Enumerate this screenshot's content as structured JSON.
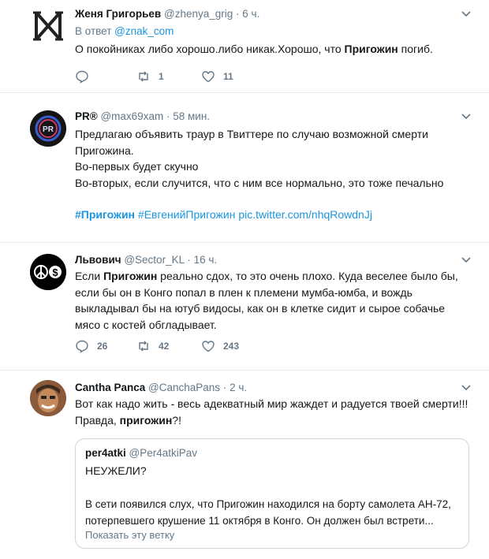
{
  "tweets": [
    {
      "name": "Женя Григорьев",
      "handle": "@zhenya_grig",
      "dot": "·",
      "time": "6 ч.",
      "reply_prefix": "В ответ ",
      "reply_handle": "@znak_com",
      "text_1": "О покойниках либо хорошо.либо никак.Хорошо, что ",
      "text_bold": "Пригожин",
      "text_2": " погиб.",
      "replies": "",
      "retweets": "1",
      "likes": "11"
    },
    {
      "name": "PR®",
      "handle": "@max69xam",
      "dot": "·",
      "time": "58 мин.",
      "line1": "Предлагаю объявить траур в Твиттере по случаю возможной смерти",
      "line2": "Пригожина.",
      "line3": "Во-первых будет скучно",
      "line4": "Во-вторых, если случится, что с ним все нормально, это тоже печально",
      "hashtag_bold": "#Пригожин",
      "hashtag2": " #ЕвгенийПригожин",
      "pic_link": " pic.twitter.com/nhqRowdnJj"
    },
    {
      "name": "Львович",
      "handle": "@Sector_KL",
      "dot": "·",
      "time": "16 ч.",
      "text_pre": "Если ",
      "text_bold": "Пригожин",
      "text_post": " реально сдох, то это очень плохо. Куда веселее было бы, если бы он в Конго попал в плен к племени мумба-юмба, и вождь выкладывал бы на ютуб видосы, как он в клетке сидит и сырое собачье мясо с костей обгладывает.",
      "replies": "26",
      "retweets": "42",
      "likes": "243"
    },
    {
      "name": "Cantha Panca",
      "handle": "@CanchaPans",
      "dot": "·",
      "time": "2 ч.",
      "text_line1": "Вот как надо жить - весь адекватный мир жаждет и радуется твоей смерти!!!",
      "text_pre2": "Правда, ",
      "text_bold": "пригожин",
      "text_post2": "?!",
      "quote": {
        "name": "per4atki",
        "handle": "@Per4atkiPav",
        "title": "НЕУЖЕЛИ?",
        "line1": "В сети появился слух, что Пригожин находился на борту самолета АН-72,",
        "line2": "потерпевшего крушение 11 октября в Конго. Он должен был встрети...",
        "show_thread": "Показать эту ветку"
      }
    }
  ],
  "colors": {
    "link": "#1b95e0",
    "muted": "#657786",
    "border": "#e6ecf0",
    "text": "#14171a"
  },
  "icons": [
    "reply-icon",
    "retweet-icon",
    "like-icon",
    "caret-down-icon"
  ]
}
